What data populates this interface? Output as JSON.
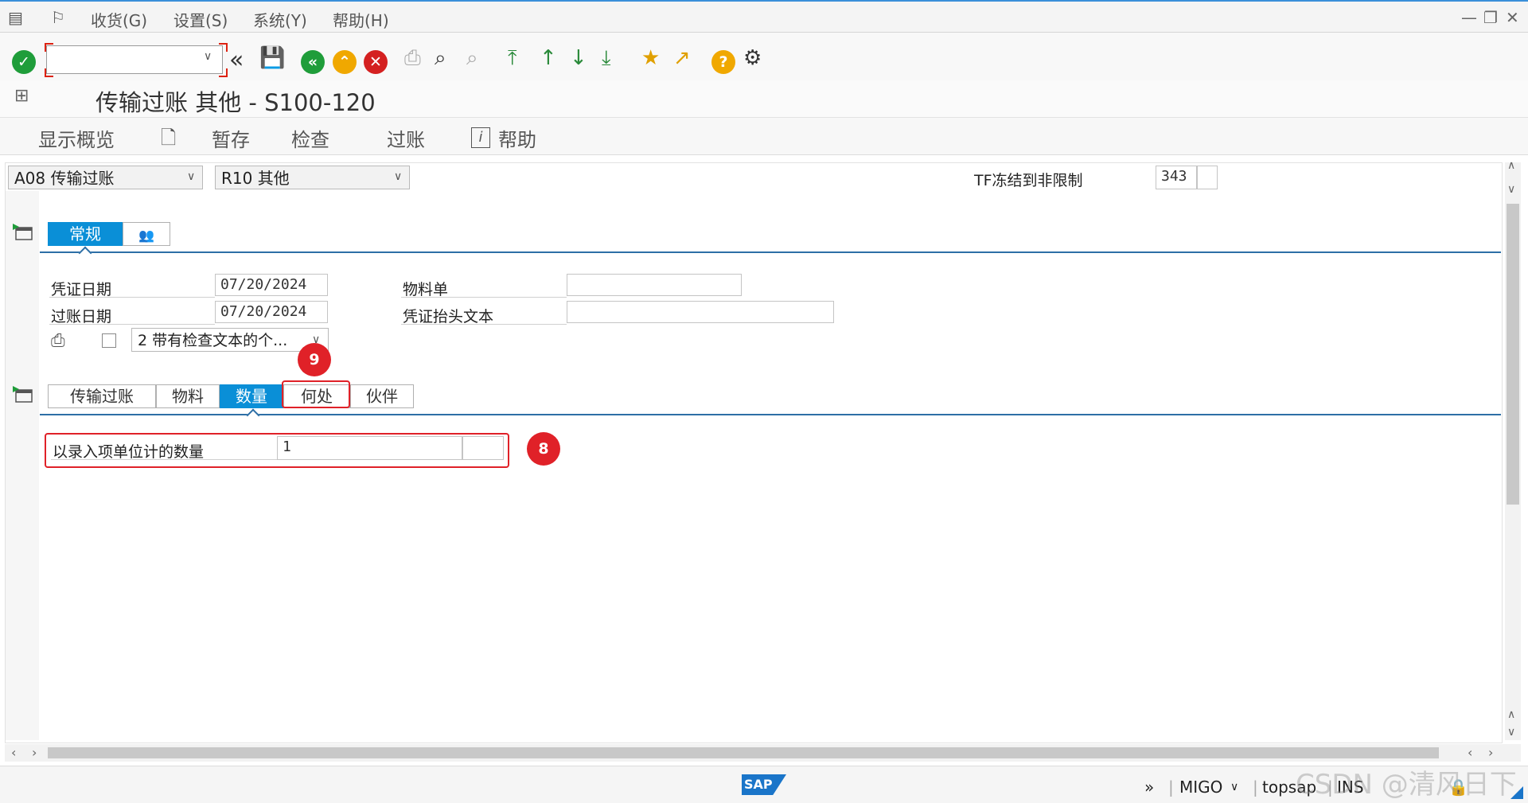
{
  "menubar": {
    "items": [
      "收货(G)",
      "设置(S)",
      "系统(Y)",
      "帮助(H)"
    ]
  },
  "toolbar": {
    "command_field_value": ""
  },
  "title": "传输过账 其他 - S100-120",
  "app_toolbar": {
    "items": [
      "显示概览",
      "暂存",
      "检查",
      "过账",
      "帮助"
    ]
  },
  "header": {
    "transaction_select": "A08 传输过账",
    "reference_select": "R10 其他",
    "movement_label": "TF冻结到非限制",
    "movement_type": "343"
  },
  "header_tabs": [
    {
      "label": "常规",
      "active": true
    }
  ],
  "general": {
    "doc_date_label": "凭证日期",
    "doc_date_value": "07/20/2024",
    "posting_date_label": "过账日期",
    "posting_date_value": "07/20/2024",
    "material_slip_label": "物料单",
    "material_slip_value": "",
    "header_text_label": "凭证抬头文本",
    "header_text_value": "",
    "print_select": "2 带有检查文本的个..."
  },
  "item_tabs": [
    {
      "label": "传输过账",
      "active": false
    },
    {
      "label": "物料",
      "active": false
    },
    {
      "label": "数量",
      "active": true
    },
    {
      "label": "何处",
      "active": false
    },
    {
      "label": "伙伴",
      "active": false
    }
  ],
  "quantity": {
    "label": "以录入项单位计的数量",
    "value": "1",
    "unit": ""
  },
  "annotations": {
    "badge_quantity": "8",
    "badge_where": "9"
  },
  "statusbar": {
    "transaction": "MIGO",
    "system": "topsap",
    "mode": "INS"
  },
  "watermark": "CSDN @清风日下",
  "colors": {
    "active_tab": "#0a8fd7",
    "annotation_red": "#e02128",
    "tab_rule": "#2d6fa6"
  }
}
